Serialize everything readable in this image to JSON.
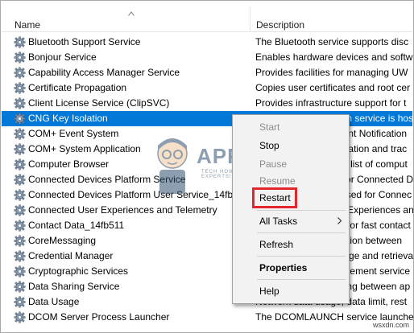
{
  "header": {
    "name_label": "Name",
    "description_label": "Description"
  },
  "rows": [
    {
      "name": "Bluetooth Support Service",
      "desc": "The Bluetooth service supports disc"
    },
    {
      "name": "Bonjour Service",
      "desc": "Enables hardware devices and softw"
    },
    {
      "name": "Capability Access Manager Service",
      "desc": "Provides facilities for managing UW"
    },
    {
      "name": "Certificate Propagation",
      "desc": "Copies user certificates and root cer"
    },
    {
      "name": "Client License Service (ClipSVC)",
      "desc": "Provides infrastructure support for t"
    },
    {
      "name": "CNG Key Isolation",
      "desc": "The CNG key isolation service is hos"
    },
    {
      "name": "COM+ Event System",
      "desc": "Supports System Event Notification"
    },
    {
      "name": "COM+ System Application",
      "desc": "Manages the configuration and trac"
    },
    {
      "name": "Computer Browser",
      "desc": "Maintains an updated list of comput"
    },
    {
      "name": "Connected Devices Platform Service",
      "desc": "This service is used for Connected D"
    },
    {
      "name": "Connected Devices Platform User Service_14fb511",
      "desc": "This user service is used for Connec"
    },
    {
      "name": "Connected User Experiences and Telemetry",
      "desc": "The Connected User Experiences an"
    },
    {
      "name": "Contact Data_14fb511",
      "desc": "Indexes contact data for fast contact"
    },
    {
      "name": "CoreMessaging",
      "desc": "Manages communication between"
    },
    {
      "name": "Credential Manager",
      "desc": "Provides secure storage and retrieva"
    },
    {
      "name": "Cryptographic Services",
      "desc": "Provides three management service"
    },
    {
      "name": "Data Sharing Service",
      "desc": "Provides data brokering between ap"
    },
    {
      "name": "Data Usage",
      "desc": "Network data usage, data limit, rest"
    },
    {
      "name": "DCOM Server Process Launcher",
      "desc": "The DCOMLAUNCH service launches"
    }
  ],
  "selected_row": "CNG Key Isolation",
  "context_menu": {
    "start": "Start",
    "stop": "Stop",
    "pause": "Pause",
    "resume": "Resume",
    "restart": "Restart",
    "all_tasks": "All Tasks",
    "refresh": "Refresh",
    "properties": "Properties",
    "help": "Help"
  },
  "watermark": {
    "text": "APPUALS",
    "sub": "TECH HOW-TO'S FROM THE EXPERTS!"
  },
  "source_label": "wsxdn.com",
  "colors": {
    "selection": "#0078d7",
    "highlight_box": "#e3262a"
  },
  "icons": {
    "service": "gear-icon",
    "sort": "sort-up-icon",
    "submenu": "chevron-right-icon"
  }
}
